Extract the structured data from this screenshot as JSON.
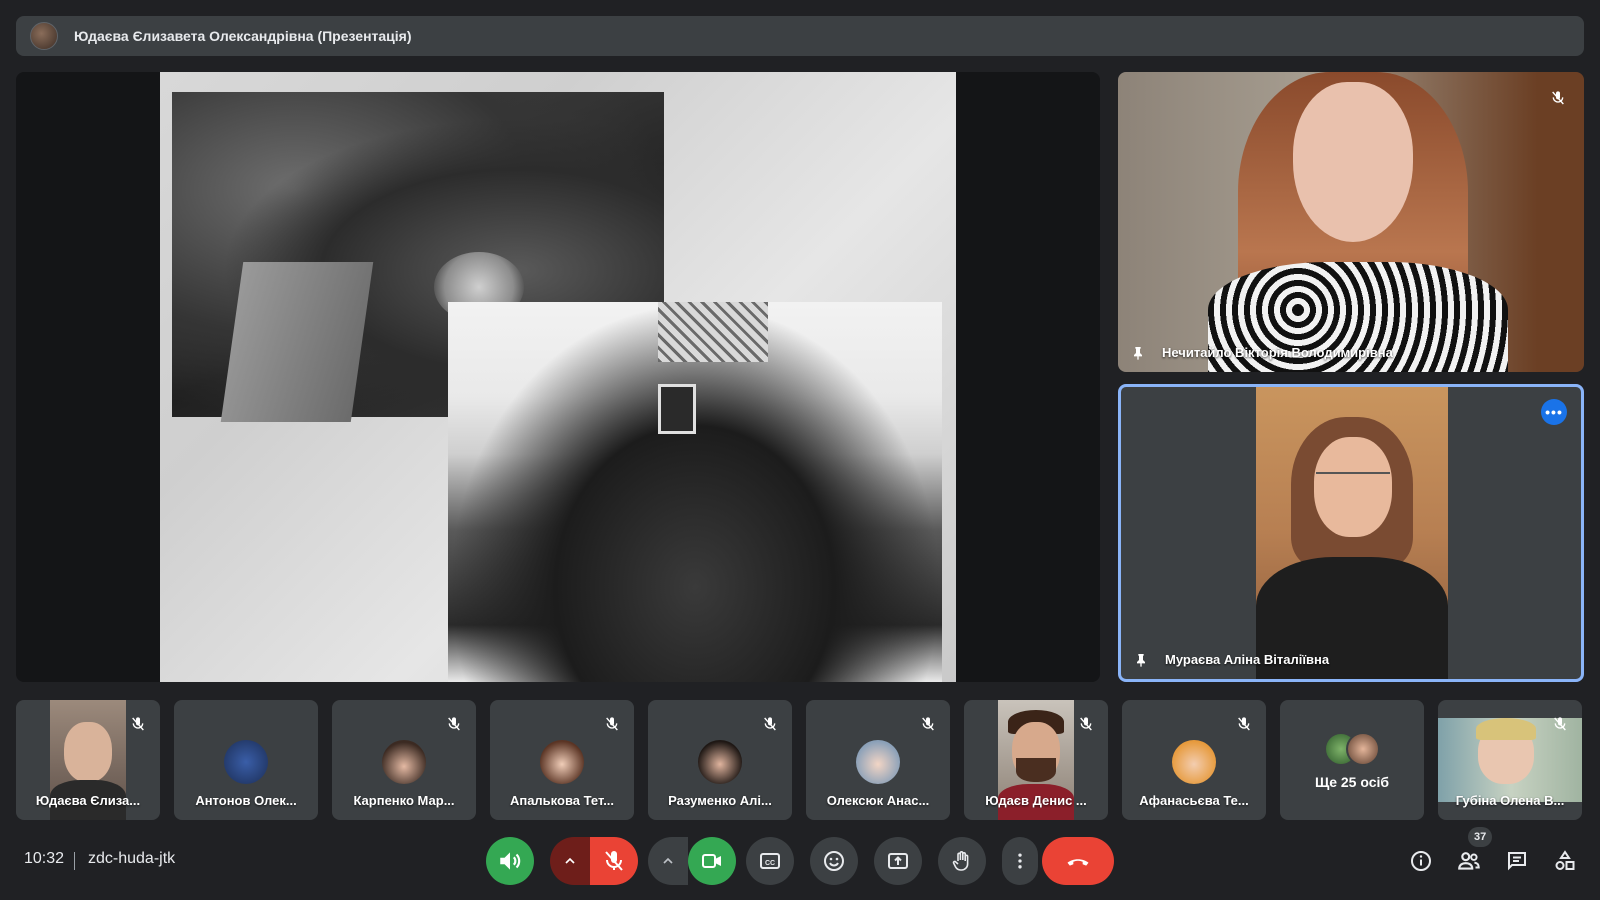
{
  "presenter_bar": {
    "title": "Юдаєва Єлизавета Олександрівна (Презентація)"
  },
  "main_tiles": [
    {
      "name": "Нечитайло Вікторія Володимирівна",
      "muted": true,
      "pinned": false
    },
    {
      "name": "Мураєва Аліна Віталіївна",
      "muted": false,
      "active_speaker": true
    }
  ],
  "thumbnails": [
    {
      "name": "Юдаєва Єлиза...",
      "muted": true,
      "video": true
    },
    {
      "name": "Антонов Олек...",
      "muted": false,
      "video": false
    },
    {
      "name": "Карпенко Мар...",
      "muted": true,
      "video": false
    },
    {
      "name": "Апалькова Тет...",
      "muted": true,
      "video": false
    },
    {
      "name": "Разуменко Алі...",
      "muted": true,
      "video": false
    },
    {
      "name": "Олексюк Анас...",
      "muted": true,
      "video": false
    },
    {
      "name": "Юдаєв Денис ...",
      "muted": true,
      "video": true
    },
    {
      "name": "Афанасьєва Те...",
      "muted": true,
      "video": false
    },
    {
      "name": "Ще 25 осіб",
      "muted": false,
      "video": false
    },
    {
      "name": "Губіна Олена В...",
      "muted": true,
      "video": true
    }
  ],
  "bottom_bar": {
    "time": "10:32",
    "meeting_code": "zdc-huda-jtk",
    "participant_count": "37",
    "controls": [
      "speaker-icon",
      "chevron-up-icon",
      "mic-off-icon",
      "chevron-up-icon",
      "camera-icon",
      "captions-icon",
      "emoji-icon",
      "present-screen-icon",
      "raise-hand-icon",
      "more-vert-icon",
      "end-call-icon"
    ],
    "right_controls": [
      "info-icon",
      "people-icon",
      "chat-icon",
      "activities-icon"
    ]
  },
  "colors": {
    "background": "#202124",
    "surface": "#3c4043",
    "accent_blue": "#8ab4f8",
    "green": "#34a853",
    "red": "#ea4335"
  }
}
